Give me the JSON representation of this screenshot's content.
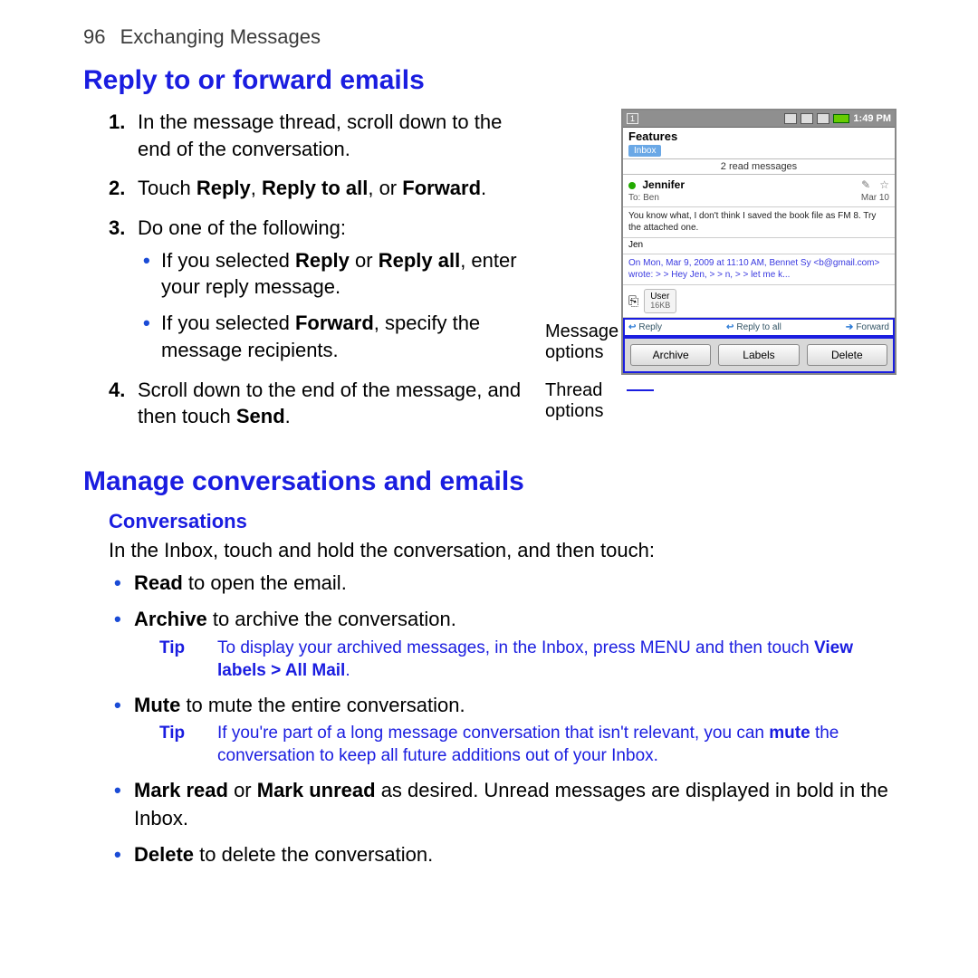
{
  "header": {
    "page_number": "96",
    "chapter": "Exchanging Messages"
  },
  "section1": {
    "title": "Reply to or forward emails",
    "steps": [
      {
        "n": "1.",
        "text_a": "In the message thread, scroll down to the end of the conversation."
      },
      {
        "n": "2.",
        "text_a": "Touch ",
        "b1": "Reply",
        "text_b": ", ",
        "b2": "Reply to all",
        "text_c": ", or ",
        "b3": "Forward",
        "text_d": "."
      },
      {
        "n": "3.",
        "text_a": "Do one of the following:",
        "subs": [
          {
            "pre": "If you selected ",
            "b1": "Reply",
            "mid": " or ",
            "b2": "Reply all",
            "post": ", enter your reply message."
          },
          {
            "pre": "If you selected ",
            "b1": "Forward",
            "post": ", specify the message recipients."
          }
        ]
      },
      {
        "n": "4.",
        "text_a": "Scroll down to the end of the message, and then touch ",
        "b1": "Send",
        "text_b": "."
      }
    ],
    "callouts": {
      "message_options": "Message options",
      "thread_options": "Thread options"
    }
  },
  "screenshot": {
    "time": "1:49 PM",
    "features_label": "Features",
    "inbox_chip": "Inbox",
    "read_messages": "2 read messages",
    "from": "Jennifer",
    "to": "To: Ben",
    "date": "Mar 10",
    "body": "You know what, I don't think I saved the book file as FM 8.  Try the attached one.",
    "sig": "Jen",
    "quote": "On Mon, Mar 9, 2009 at 11:10 AM, Bennet Sy <b@gmail.com> wrote: > > Hey Jen, >  > n, >  > let me k...",
    "attach_name": "User",
    "attach_size": "16KB",
    "reply": "Reply",
    "reply_all": "Reply to all",
    "forward": "Forward",
    "archive": "Archive",
    "labels": "Labels",
    "delete": "Delete"
  },
  "section2": {
    "title": "Manage conversations and emails",
    "sub": "Conversations",
    "intro": "In the Inbox, touch and hold the conversation, and then touch:",
    "items": [
      {
        "b": "Read",
        "rest": " to open the email."
      },
      {
        "b": "Archive",
        "rest": " to archive the conversation.",
        "tip": {
          "label": "Tip",
          "pre": "To display your archived messages, in the Inbox, press MENU and then touch ",
          "blink": "View labels > All Mail",
          "post": "."
        }
      },
      {
        "b": "Mute",
        "rest": " to mute the entire conversation.",
        "tip": {
          "label": "Tip",
          "pre": "If you're part of a long message conversation that isn't relevant, you can ",
          "b": "mute",
          "post": " the conversation to keep all future additions out of your Inbox."
        }
      },
      {
        "b": "Mark read",
        "mid": " or ",
        "b2": "Mark unread",
        "rest": " as desired. Unread messages are displayed in bold in the Inbox."
      },
      {
        "b": "Delete",
        "rest": " to delete the conversation."
      }
    ]
  }
}
